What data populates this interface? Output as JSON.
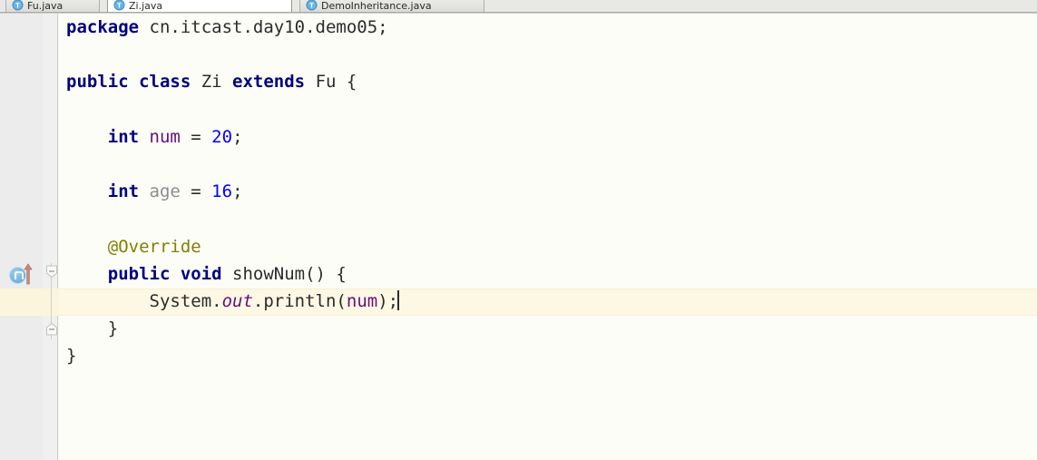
{
  "window": {
    "app": "IntelliJ IDEA Java Editor"
  },
  "tabbar": {
    "tabs": [
      {
        "label": "Fu.java",
        "icon": "java-class-icon",
        "active": false
      },
      {
        "label": "Zi.java",
        "icon": "java-class-icon",
        "active": true
      },
      {
        "label": "DemoInheritance.java",
        "icon": "java-class-icon",
        "active": false
      }
    ]
  },
  "gutter": {
    "override_marker": "overriding-method-icon",
    "override_arrow": "arrow-up-icon",
    "fold_open_top": "fold-collapse-marker",
    "fold_open_bottom": "fold-collapse-end-marker"
  },
  "editor": {
    "file_name": "Zi.java",
    "caret_line": 9,
    "lines": [
      {
        "n": 1,
        "tokens": [
          {
            "t": "package ",
            "c": "kw"
          },
          {
            "t": "cn.itcast.day10.demo05;",
            "c": "plain"
          }
        ]
      },
      {
        "n": 2,
        "tokens": []
      },
      {
        "n": 3,
        "tokens": [
          {
            "t": "public class ",
            "c": "kw"
          },
          {
            "t": "Zi ",
            "c": "plain"
          },
          {
            "t": "extends ",
            "c": "kw"
          },
          {
            "t": "Fu {",
            "c": "plain"
          }
        ]
      },
      {
        "n": 4,
        "tokens": []
      },
      {
        "n": 5,
        "tokens": [
          {
            "t": "    int ",
            "c": "kw"
          },
          {
            "t": "num ",
            "c": "fld"
          },
          {
            "t": "= ",
            "c": "plain"
          },
          {
            "t": "20",
            "c": "num"
          },
          {
            "t": ";",
            "c": "plain"
          }
        ]
      },
      {
        "n": 6,
        "tokens": []
      },
      {
        "n": 7,
        "tokens": [
          {
            "t": "    int ",
            "c": "kw"
          },
          {
            "t": "age ",
            "c": "gray"
          },
          {
            "t": "= ",
            "c": "plain"
          },
          {
            "t": "16",
            "c": "num"
          },
          {
            "t": ";",
            "c": "plain"
          }
        ]
      },
      {
        "n": 8,
        "tokens": []
      },
      {
        "n": 9,
        "tokens": [
          {
            "t": "    @Override",
            "c": "anno"
          }
        ]
      },
      {
        "n": 10,
        "tokens": [
          {
            "t": "    public void ",
            "c": "kw"
          },
          {
            "t": "showNum() {",
            "c": "plain"
          }
        ]
      },
      {
        "n": 11,
        "highlighted": true,
        "caret": true,
        "tokens": [
          {
            "t": "        System.",
            "c": "plain"
          },
          {
            "t": "out",
            "c": "fldi"
          },
          {
            "t": ".println(",
            "c": "plain"
          },
          {
            "t": "num",
            "c": "fld"
          },
          {
            "t": ");",
            "c": "plain"
          }
        ]
      },
      {
        "n": 12,
        "tokens": [
          {
            "t": "    }",
            "c": "plain"
          }
        ]
      },
      {
        "n": 13,
        "tokens": [
          {
            "t": "}",
            "c": "plain"
          }
        ]
      }
    ]
  },
  "colors": {
    "editor_background": "#fdfdf8",
    "gutter_background": "#ececec",
    "caret_line_background": "#fdf8e3",
    "keyword": "#000080",
    "number": "#0000ff",
    "field": "#660e7a",
    "grayed_identifier": "#8c8c8c",
    "annotation": "#808000",
    "default_text": "#2b2b2b",
    "tab_active_background": "#ffffff",
    "tab_inactive_background": "#e0e0dd"
  }
}
